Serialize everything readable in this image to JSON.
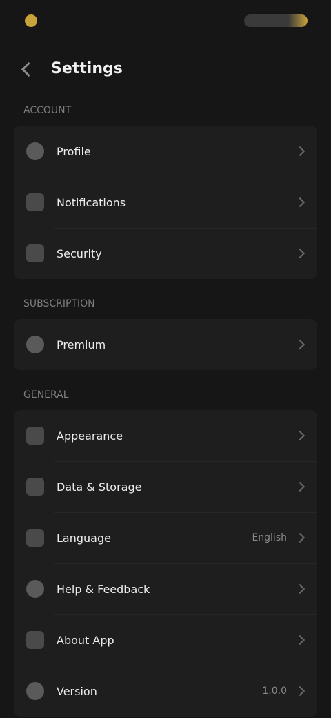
{
  "header": {
    "title": "Settings"
  },
  "sections": {
    "account": {
      "label": "ACCOUNT",
      "items": [
        {
          "label": "Profile",
          "icon": "user-icon"
        },
        {
          "label": "Notifications",
          "icon": "bell-icon"
        },
        {
          "label": "Security",
          "icon": "shield-icon"
        }
      ]
    },
    "premium": {
      "label": "SUBSCRIPTION",
      "items": [
        {
          "label": "Premium",
          "icon": "star-icon"
        }
      ]
    },
    "general": {
      "label": "GENERAL",
      "items": [
        {
          "label": "Appearance",
          "icon": "palette-icon",
          "value": ""
        },
        {
          "label": "Data & Storage",
          "icon": "database-icon",
          "value": ""
        },
        {
          "label": "Language",
          "icon": "globe-icon",
          "value": "English"
        },
        {
          "label": "Help & Feedback",
          "icon": "help-icon",
          "value": ""
        },
        {
          "label": "About App",
          "icon": "info-icon",
          "value": ""
        },
        {
          "label": "Version",
          "icon": "tag-icon",
          "value": "1.0.0"
        }
      ]
    }
  },
  "colors": {
    "accent": "#c9a23a",
    "background": "#161616",
    "card": "#1e1e1e"
  }
}
